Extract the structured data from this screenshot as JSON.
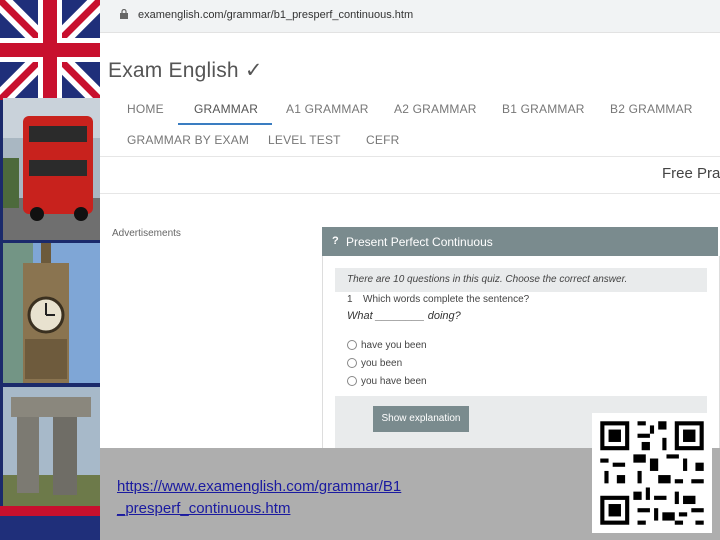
{
  "browser": {
    "url": "examenglish.com/grammar/b1_presperf_continuous.htm"
  },
  "site": {
    "logo": "Exam English ✓",
    "nav_row1": [
      "HOME",
      "GRAMMAR",
      "A1 GRAMMAR",
      "A2 GRAMMAR",
      "B1 GRAMMAR",
      "B2 GRAMMAR"
    ],
    "nav_row2": [
      "GRAMMAR BY EXAM",
      "LEVEL TEST",
      "CEFR"
    ],
    "active_nav": "GRAMMAR",
    "free_practice": "Free Prac",
    "ads_label": "Advertisements"
  },
  "quiz": {
    "icon": "?",
    "title": "Present Perfect Continuous",
    "instructions": "There are 10 questions in this quiz. Choose the correct answer.",
    "question_number": "1",
    "question": "Which words complete the sentence?",
    "sentence": "What ________ doing?",
    "options": [
      "have you been",
      "you been",
      "you have been"
    ],
    "explain_button": "Show explanation"
  },
  "caption": {
    "link_line1": "https://www.examenglish.com/grammar/B1",
    "link_line2": "_presperf_continuous.htm"
  },
  "icons": {
    "lock": "lock-icon",
    "qr": "qr-code-icon"
  },
  "colors": {
    "nav_active_underline": "#3a7dc1",
    "quiz_header": "#7a8b8e",
    "caption_bg": "#aeaeae",
    "link": "#1a1aa0"
  }
}
